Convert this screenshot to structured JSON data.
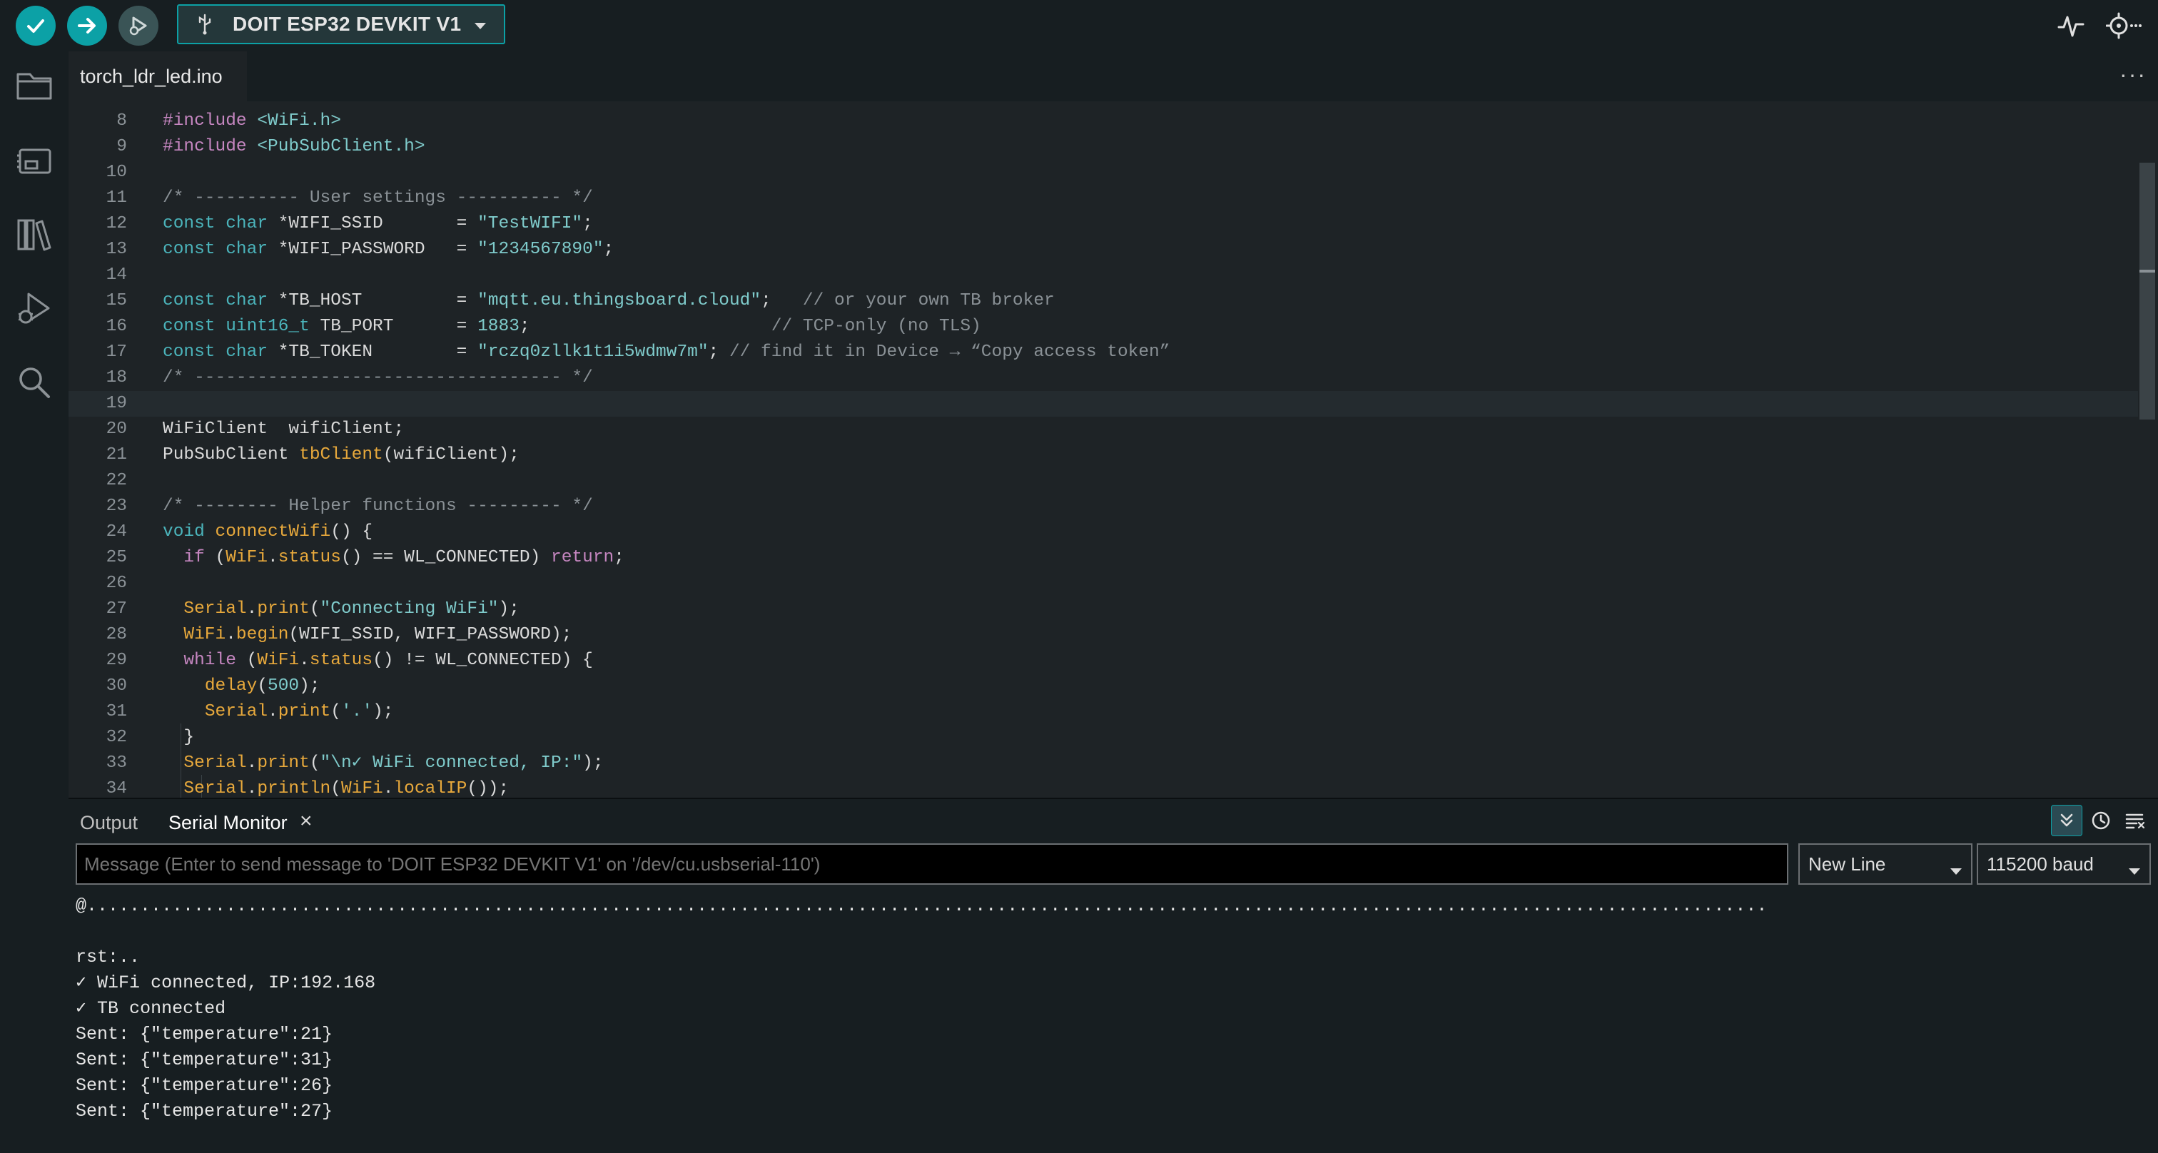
{
  "toolbar": {
    "board_label": "DOIT ESP32 DEVKIT V1",
    "buttons": [
      "verify-icon",
      "upload-icon",
      "debug-icon"
    ],
    "right_icons": [
      "serial-plotter-icon",
      "serial-monitor-icon"
    ]
  },
  "activity_bar": [
    "folder-icon",
    "board-manager-icon",
    "library-icon",
    "debug-icon",
    "search-icon"
  ],
  "editor": {
    "tab_label": "torch_ldr_led.ino",
    "current_line": 19,
    "lines": [
      {
        "n": "8",
        "text": "#include <WiFi.h>"
      },
      {
        "n": "9",
        "text": "#include <PubSubClient.h>"
      },
      {
        "n": "10",
        "text": ""
      },
      {
        "n": "11",
        "text": "/* ---------- User settings ---------- */"
      },
      {
        "n": "12",
        "text": "const char *WIFI_SSID       = \"TestWIFI\";"
      },
      {
        "n": "13",
        "text": "const char *WIFI_PASSWORD   = \"1234567890\";"
      },
      {
        "n": "14",
        "text": ""
      },
      {
        "n": "15",
        "text": "const char *TB_HOST         = \"mqtt.eu.thingsboard.cloud\";   // or your own TB broker"
      },
      {
        "n": "16",
        "text": "const uint16_t TB_PORT      = 1883;                       // TCP-only (no TLS)"
      },
      {
        "n": "17",
        "text": "const char *TB_TOKEN        = \"rczq0zllk1t1i5wdmw7m\"; // find it in Device → “Copy access token”"
      },
      {
        "n": "18",
        "text": "/* ----------------------------------- */"
      },
      {
        "n": "19",
        "text": ""
      },
      {
        "n": "20",
        "text": "WiFiClient  wifiClient;"
      },
      {
        "n": "21",
        "text": "PubSubClient tbClient(wifiClient);"
      },
      {
        "n": "22",
        "text": ""
      },
      {
        "n": "23",
        "text": "/* -------- Helper functions --------- */"
      },
      {
        "n": "24",
        "text": "void connectWifi() {"
      },
      {
        "n": "25",
        "text": "  if (WiFi.status() == WL_CONNECTED) return;"
      },
      {
        "n": "26",
        "text": ""
      },
      {
        "n": "27",
        "text": "  Serial.print(\"Connecting WiFi\");"
      },
      {
        "n": "28",
        "text": "  WiFi.begin(WIFI_SSID, WIFI_PASSWORD);"
      },
      {
        "n": "29",
        "text": "  while (WiFi.status() != WL_CONNECTED) {"
      },
      {
        "n": "30",
        "text": "    delay(500);"
      },
      {
        "n": "31",
        "text": "    Serial.print('.');"
      },
      {
        "n": "32",
        "text": "  }"
      },
      {
        "n": "33",
        "text": "  Serial.print(\"\\n✓ WiFi connected, IP:\");"
      },
      {
        "n": "34",
        "text": "  Serial.println(WiFi.localIP());"
      }
    ]
  },
  "panel": {
    "tabs": [
      "Output",
      "Serial Monitor"
    ],
    "active_tab": "Serial Monitor",
    "close_glyph": "×",
    "message_placeholder": "Message (Enter to send message to 'DOIT ESP32 DEVKIT V1' on '/dev/cu.usbserial-110')",
    "line_ending": "New Line",
    "baud": "115200 baud",
    "output_lines": [
      "@.............................................................................................................................................................",
      "",
      "rst:..",
      "✓ WiFi connected, IP:192.168",
      "✓ TB connected",
      "Sent: {\"temperature\":21}",
      "Sent: {\"temperature\":31}",
      "Sent: {\"temperature\":26}",
      "Sent: {\"temperature\":27}"
    ]
  },
  "colors": {
    "accent": "#0ca1a6",
    "toolbar_bg": "#171e21",
    "editor_bg": "#1e2326"
  }
}
